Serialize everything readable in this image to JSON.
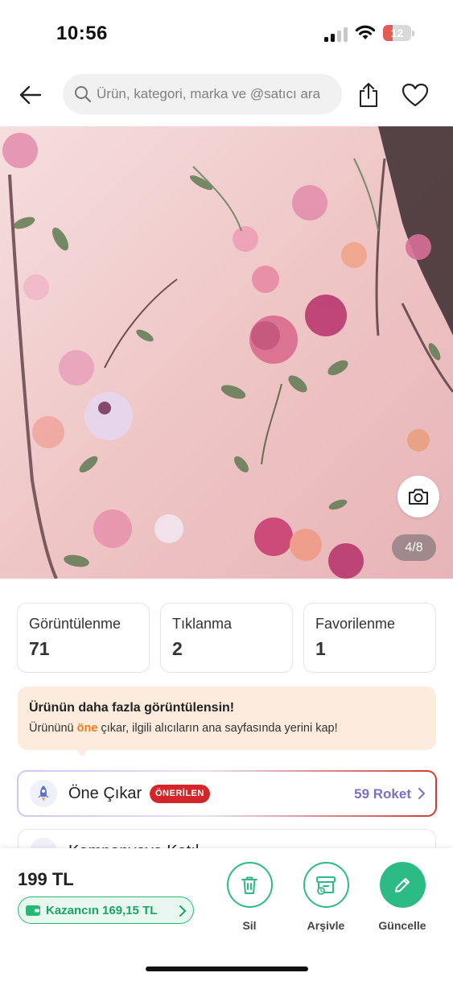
{
  "status_bar": {
    "time": "10:56",
    "battery": "12",
    "battery_color": "#e25b55"
  },
  "header": {
    "search_placeholder": "Ürün, kategori, marka ve @satıcı ara",
    "back_icon": "arrow-left-icon",
    "share_icon": "share-icon",
    "favorite_icon": "heart-icon"
  },
  "gallery": {
    "counter": "4/8",
    "current_index": 4,
    "total": 8,
    "camera_icon": "camera-icon"
  },
  "stats": [
    {
      "label": "Görüntülenme",
      "value": "71"
    },
    {
      "label": "Tıklanma",
      "value": "2"
    },
    {
      "label": "Favorilenme",
      "value": "1"
    }
  ],
  "promo": {
    "title": "Ürünün daha fazla görüntülensin!",
    "text_before": "Ürününü ",
    "highlight": "öne",
    "text_after": " çıkar, ilgili alıcıların ana sayfasında yerini kap!",
    "highlight_color": "#f27a1a"
  },
  "feature": {
    "title": "Öne Çıkar",
    "badge": "ÖNERİLEN",
    "cost": "59 Roket",
    "icon": "rocket-icon"
  },
  "campaign": {
    "title": "Kampanyaya Katıl",
    "icon": "campaign-icon"
  },
  "bottom": {
    "price": "199 TL",
    "earnings": "Kazancın 169,15 TL",
    "wallet_icon": "wallet-icon",
    "actions": [
      {
        "label": "Sil",
        "icon": "trash-icon"
      },
      {
        "label": "Arşivle",
        "icon": "archive-icon"
      },
      {
        "label": "Güncelle",
        "icon": "pencil-icon"
      }
    ],
    "accent_color": "#2cbb85"
  }
}
